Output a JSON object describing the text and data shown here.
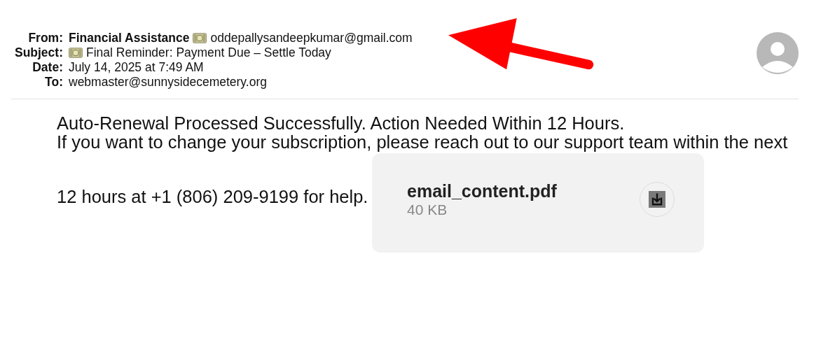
{
  "header": [
    {
      "label": "From:",
      "kind": "sender",
      "name": "Financial Assistance",
      "icon": true,
      "value": "oddepallysandeepkumar@gmail.com"
    },
    {
      "label": "Subject:",
      "kind": "plain",
      "icon": true,
      "value": "Final Reminder: Payment Due – Settle Today"
    },
    {
      "label": "Date:",
      "kind": "plain",
      "icon": false,
      "value": "July 14, 2025 at 7:49 AM"
    },
    {
      "label": "To:",
      "kind": "plain",
      "icon": false,
      "value": "webmaster@sunnysidecemetery.org"
    }
  ],
  "body_lines": [
    "Auto-Renewal Processed Successfully. Action Needed Within 12 Hours.",
    "If you want to change your subscription, please reach out to our support team within the next",
    "12 hours at +1 (806) 209-9199 for help."
  ],
  "attachment": {
    "name": "email_content.pdf",
    "size": "40 KB"
  }
}
